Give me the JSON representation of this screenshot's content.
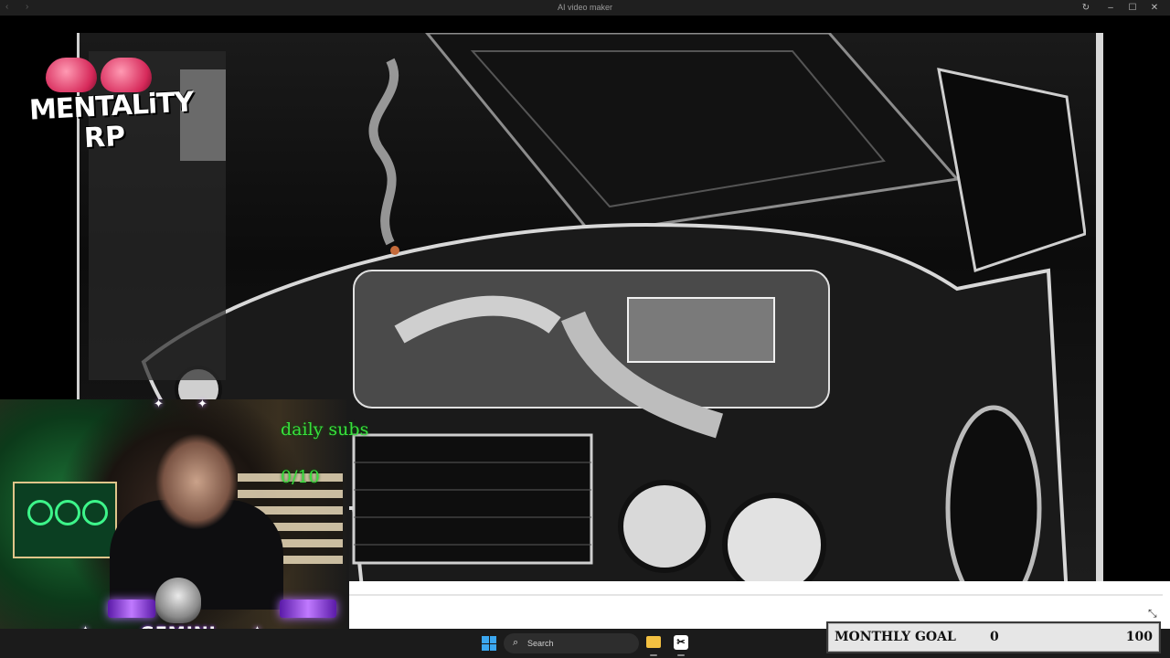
{
  "window": {
    "title": "AI video maker",
    "nav_back": "‹",
    "nav_forward": "›",
    "controls": {
      "refresh": "↻",
      "minimize": "–",
      "maximize": "☐",
      "close": "✕"
    }
  },
  "logo": {
    "line1": "MENTALiTY",
    "line2": "RP"
  },
  "webcam": {
    "subs_label": "daily subs",
    "subs_count": "0/10"
  },
  "badge": {
    "name": "GEMINI"
  },
  "taskbar": {
    "search_placeholder": "Search",
    "search_icon": "⌕",
    "apps": [
      "start-icon",
      "file-explorer-icon",
      "capcut-icon"
    ]
  },
  "goal": {
    "label": "MONTHLY GOAL",
    "current": "0",
    "target": "100"
  },
  "colors": {
    "subs_text": "#37e03c",
    "accent_purple": "#b06aff",
    "brand_pink": "#d6295a"
  }
}
